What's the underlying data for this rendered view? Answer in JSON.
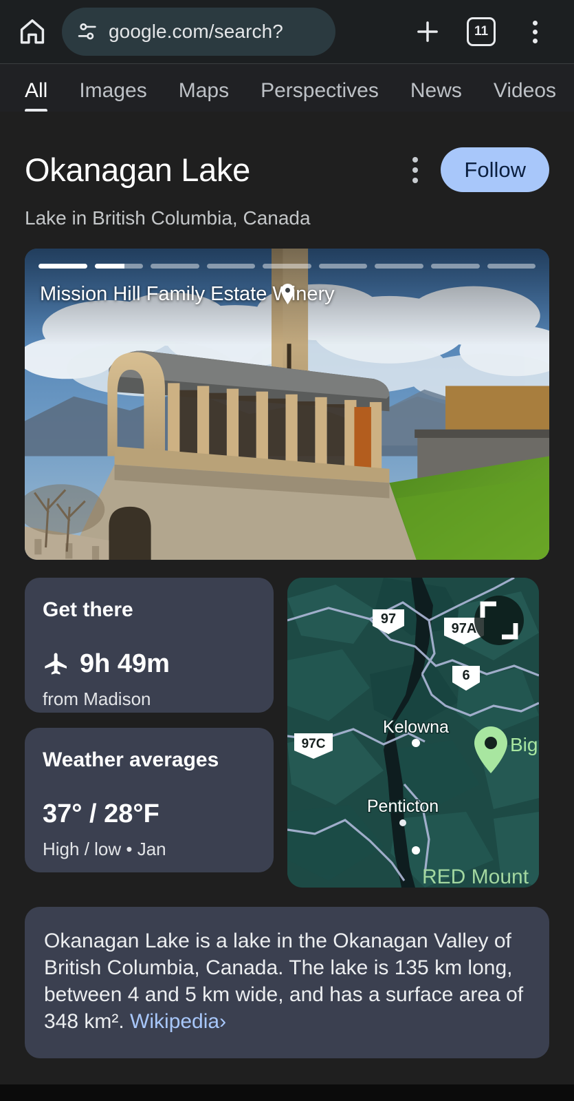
{
  "browser": {
    "home_icon": "home-icon",
    "tune_icon": "tune-icon",
    "url": "google.com/search?",
    "new_tab_icon": "plus-icon",
    "tab_count": "11",
    "menu_icon": "more-vertical-icon"
  },
  "search_tabs": [
    {
      "label": "All",
      "active": true
    },
    {
      "label": "Images",
      "active": false
    },
    {
      "label": "Maps",
      "active": false
    },
    {
      "label": "Perspectives",
      "active": false
    },
    {
      "label": "News",
      "active": false
    },
    {
      "label": "Videos",
      "active": false
    }
  ],
  "knowledge_panel": {
    "title": "Okanagan Lake",
    "subtitle": "Lake in British Columbia, Canada",
    "menu_icon": "more-vertical-icon",
    "follow_label": "Follow"
  },
  "hero": {
    "caption": "Mission Hill Family Estate Winery",
    "pin_icon": "location-pin-icon",
    "segment_count": 9,
    "active_index": 0
  },
  "cards": {
    "get_there": {
      "title": "Get there",
      "icon": "airplane-icon",
      "duration": "9h 49m",
      "origin": "from Madison"
    },
    "weather": {
      "title": "Weather averages",
      "temps": "37° / 28°F",
      "detail": "High / low • Jan"
    }
  },
  "map": {
    "expand_icon": "expand-icon",
    "shields": [
      "97",
      "97A",
      "6",
      "97C"
    ],
    "cities": [
      "Kelowna",
      "Penticton"
    ],
    "poi_label": "Big",
    "area_label": "RED Mount",
    "colors": {
      "land": "#1d4a45",
      "water": "#12201f",
      "road": "#aeb8d8"
    }
  },
  "description": {
    "text": "Okanagan Lake is a lake in the Okanagan Valley of British Columbia, Canada. The lake is 135 km long, between 4 and 5 km wide, and has a surface area of 348 km². ",
    "link_label": "Wikipedia",
    "chevron": "›"
  },
  "colors": {
    "page_bg": "#1f1f1f",
    "card_bg": "#3b4050",
    "accent": "#a8c7fa",
    "chrome_bg": "#1c1f21"
  }
}
